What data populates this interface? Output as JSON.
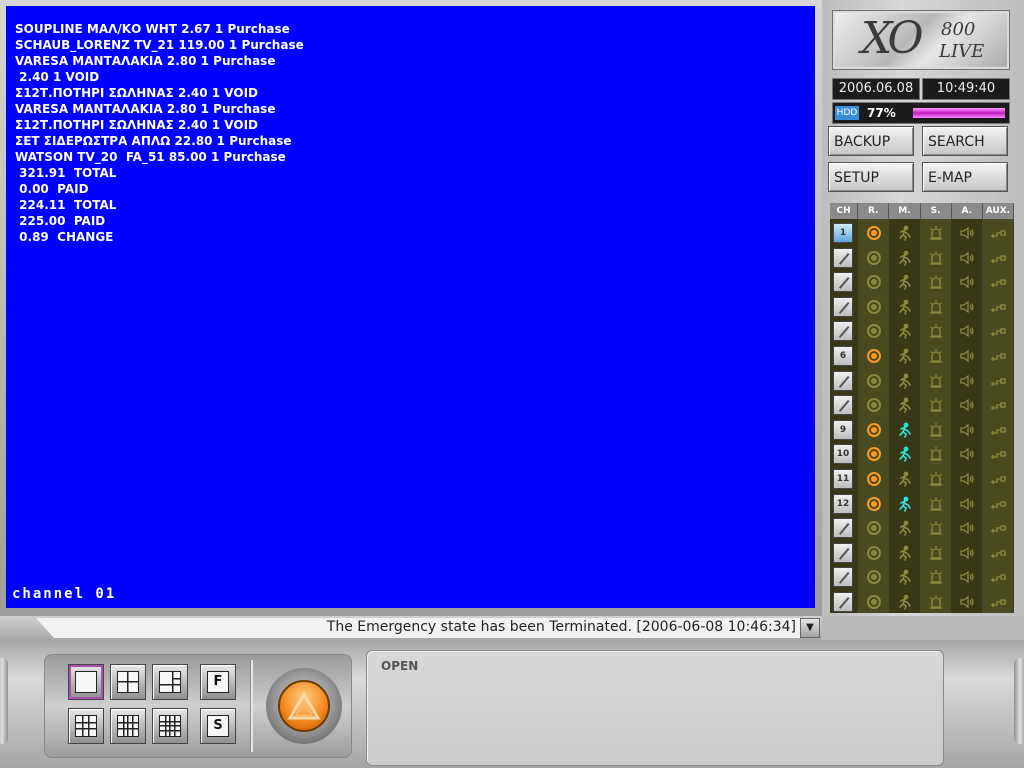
{
  "screen": {
    "pos_lines": [
      "SOUPLINE ΜΑΛ/ΚΟ WHT 2.67 1 Purchase",
      "SCHAUB_LORENZ TV_21 119.00 1 Purchase",
      "VARESA ΜΑΝΤΑΛΑΚΙΑ 2.80 1 Purchase",
      " 2.40 1 VOID",
      "Σ12Τ.ΠΟΤΗΡΙ ΣΩΛΗΝΑΣ 2.40 1 VOID",
      "VARESA ΜΑΝΤΑΛΑΚΙΑ 2.80 1 Purchase",
      "Σ12Τ.ΠΟΤΗΡΙ ΣΩΛΗΝΑΣ 2.40 1 VOID",
      "ΣΕΤ ΣΙΔΕΡΩΣΤΡΑ ΑΠΛΩ 22.80 1 Purchase",
      "WATSON TV_20  FA_51 85.00 1 Purchase",
      " 321.91  TOTAL",
      " 0.00  PAID",
      " 224.11  TOTAL",
      " 225.00  PAID",
      " 0.89  CHANGE"
    ],
    "channel_label": "channel 01",
    "background_color": "#0000ff"
  },
  "status": {
    "message": "The Emergency state has been Terminated. [2006-06-08 10:46:34]",
    "dropdown_icon": "chevron-down-icon"
  },
  "panel": {
    "logo": {
      "brand": "XO",
      "model": "800",
      "mode": "LIVE"
    },
    "date": "2006.06.08",
    "time": "10:49:40",
    "hdd_label": "HDD",
    "hdd_percent_text": "77%",
    "hdd_fill_fraction": 0.77,
    "buttons": {
      "backup": "BACKUP",
      "search": "SEARCH",
      "setup": "SETUP",
      "emap": "E-MAP"
    },
    "grid_headers": [
      "CH",
      "R.",
      "M.",
      "S.",
      "A.",
      "AUX."
    ],
    "channels": [
      {
        "label": "1",
        "active": true,
        "record": true,
        "motion": false
      },
      {
        "label": "",
        "active": false,
        "record": false,
        "motion": false
      },
      {
        "label": "",
        "active": false,
        "record": false,
        "motion": false
      },
      {
        "label": "",
        "active": false,
        "record": false,
        "motion": false
      },
      {
        "label": "",
        "active": false,
        "record": false,
        "motion": false
      },
      {
        "label": "6",
        "active": false,
        "record": true,
        "motion": false
      },
      {
        "label": "",
        "active": false,
        "record": false,
        "motion": false
      },
      {
        "label": "",
        "active": false,
        "record": false,
        "motion": false
      },
      {
        "label": "9",
        "active": false,
        "record": true,
        "motion": true
      },
      {
        "label": "10",
        "active": false,
        "record": true,
        "motion": true
      },
      {
        "label": "11",
        "active": false,
        "record": true,
        "motion": false
      },
      {
        "label": "12",
        "active": false,
        "record": true,
        "motion": true
      },
      {
        "label": "",
        "active": false,
        "record": false,
        "motion": false
      },
      {
        "label": "",
        "active": false,
        "record": false,
        "motion": false
      },
      {
        "label": "",
        "active": false,
        "record": false,
        "motion": false
      },
      {
        "label": "",
        "active": false,
        "record": false,
        "motion": false
      }
    ],
    "colors": {
      "record_on": "#ff9a1a",
      "motion_on": "#33e0e0",
      "inactive_icon": "#8a8a40"
    }
  },
  "layout_buttons": {
    "single": "single-view-icon",
    "quad": "quad-view-icon",
    "six": "six-view-icon",
    "full_letter": "F",
    "nine": "nine-view-icon",
    "twelve": "twelve-view-icon",
    "sixteen": "sixteen-view-icon",
    "sequence_letter": "S"
  },
  "console": {
    "open_label": "OPEN",
    "emergency_icon": "warning-triangle-icon"
  }
}
